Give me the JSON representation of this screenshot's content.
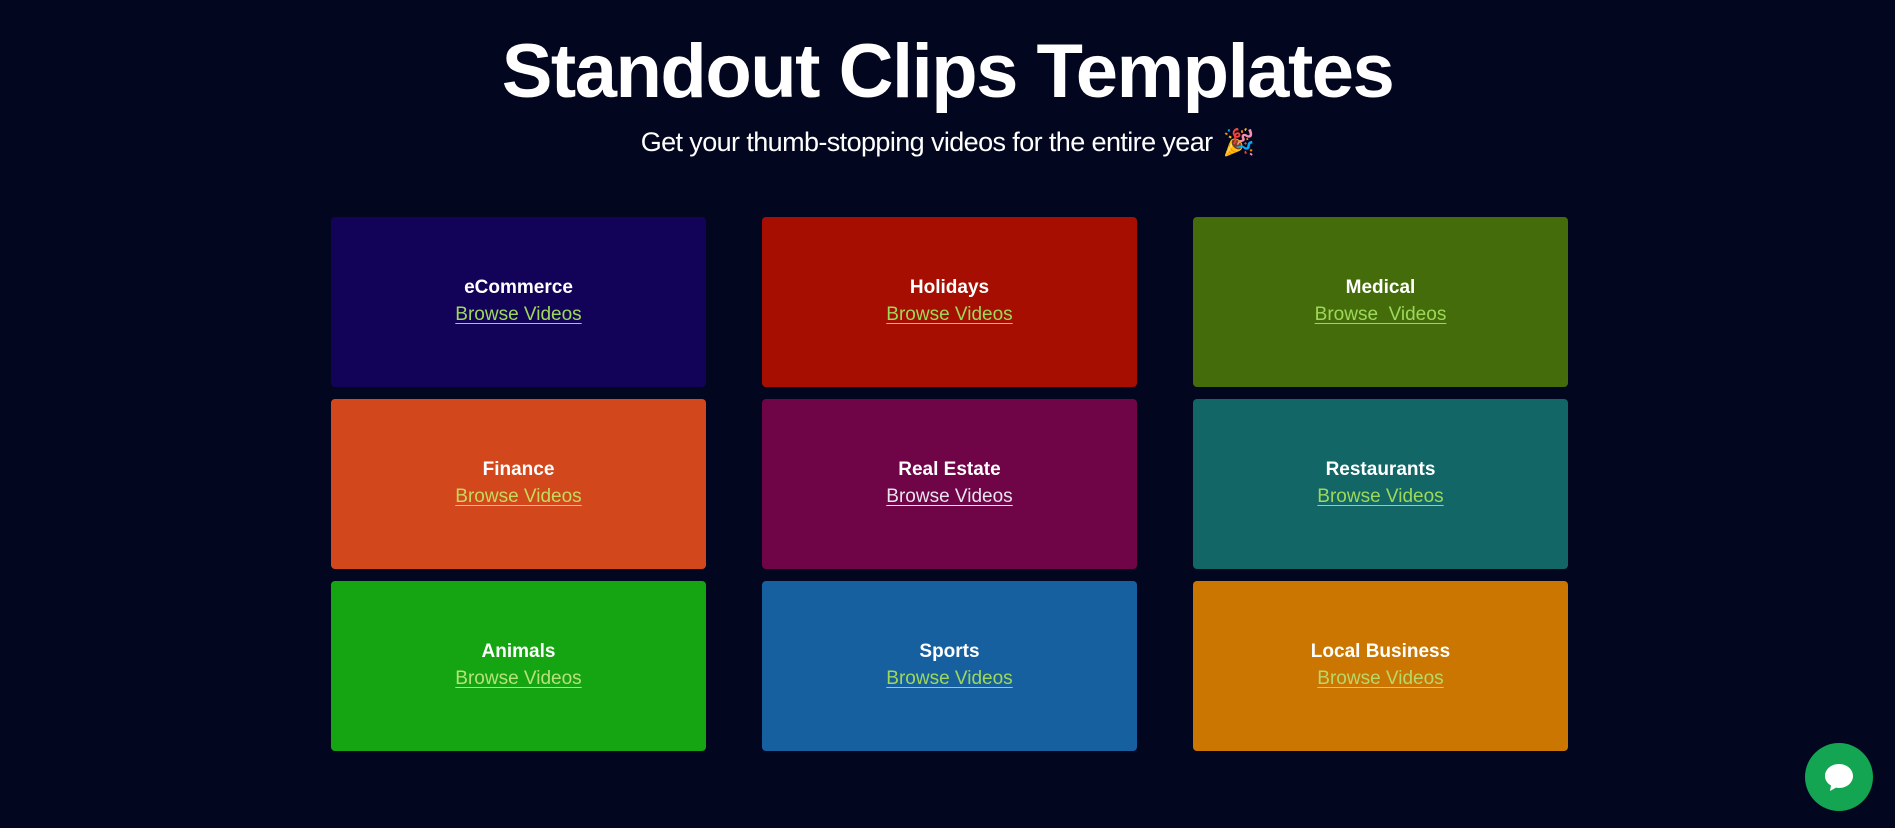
{
  "header": {
    "title": "Standout Clips Templates",
    "subtitle": "Get your thumb-stopping videos for the entire year",
    "subtitle_icon": "party-popper-icon"
  },
  "categories": [
    {
      "title": "eCommerce",
      "link": "Browse Videos",
      "color": "#130358"
    },
    {
      "title": "Holidays",
      "link": "Browse Videos",
      "color": "#a70e02"
    },
    {
      "title": "Medical",
      "link": "Browse  Videos",
      "color": "#446c0a"
    },
    {
      "title": "Finance",
      "link": "Browse Videos",
      "color": "#d2471c"
    },
    {
      "title": "Real Estate",
      "link": "Browse Videos",
      "color": "#6f0446"
    },
    {
      "title": "Restaurants",
      "link": "Browse Videos",
      "color": "#126666"
    },
    {
      "title": "Animals",
      "link": "Browse Videos",
      "color": "#15a412"
    },
    {
      "title": "Sports",
      "link": "Browse Videos",
      "color": "#1660a0"
    },
    {
      "title": "Local Business",
      "link": "Browse Videos",
      "color": "#cb7600"
    }
  ],
  "chat": {
    "icon": "chat-bubble-icon",
    "color": "#14a552"
  },
  "colors": {
    "background": "#03061f",
    "link": "#9ed85a"
  }
}
